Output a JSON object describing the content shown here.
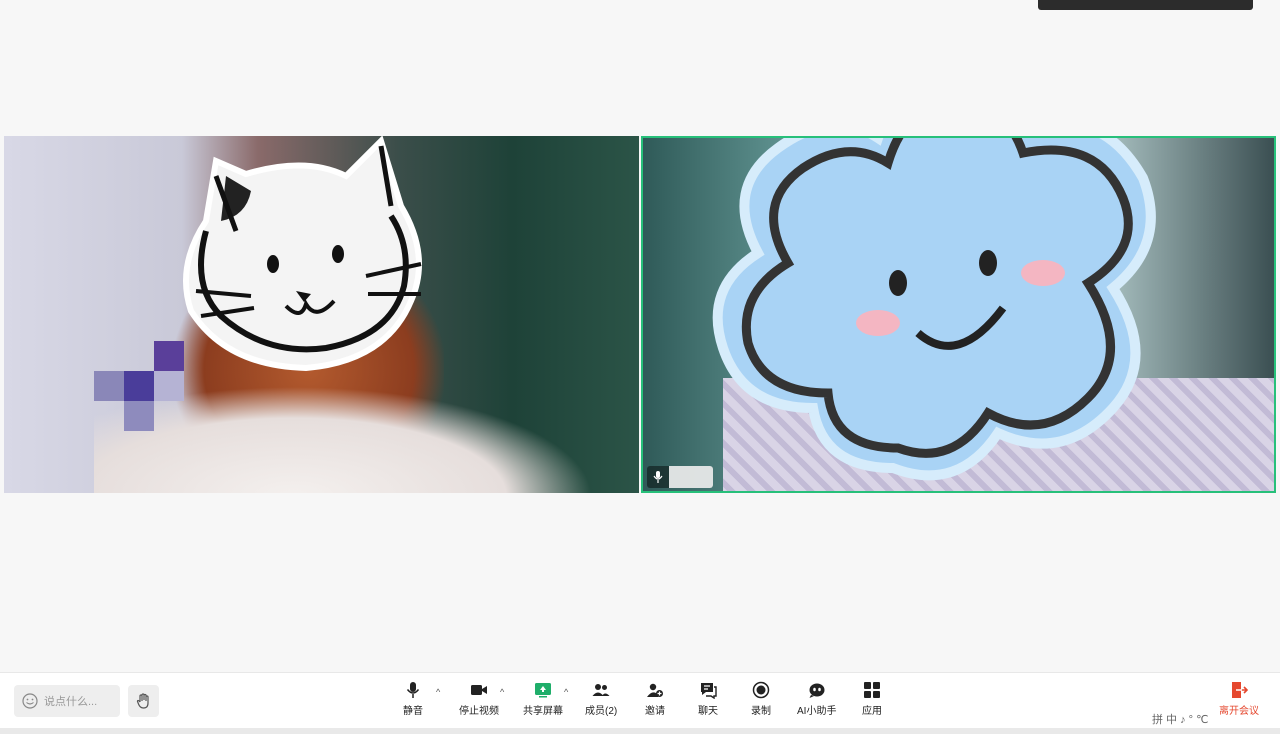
{
  "toolbar": {
    "chat_placeholder": "说点什么...",
    "mute_label": "静音",
    "stop_video_label": "停止视频",
    "share_screen_label": "共享屏幕",
    "members_label": "成员(2)",
    "invite_label": "邀请",
    "chat_label": "聊天",
    "record_label": "录制",
    "ai_assistant_label": "AI小助手",
    "apps_label": "应用",
    "leave_label": "离开会议",
    "caret": "^"
  },
  "ime": {
    "text": "拼 中 ♪ ° ℃"
  },
  "colors": {
    "speaker_border": "#27c07a",
    "leave": "#e5482f",
    "share_accent": "#1fae6a"
  }
}
